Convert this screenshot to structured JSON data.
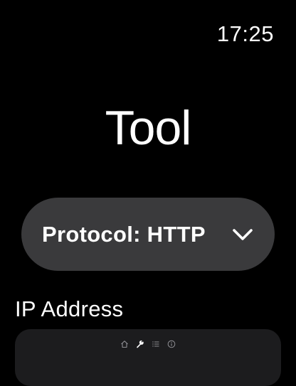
{
  "status_bar": {
    "time": "17:25"
  },
  "page": {
    "title": "Tool"
  },
  "protocol_picker": {
    "label": "Protocol: HTTP",
    "icon": "chevron-down-icon"
  },
  "ip_field": {
    "label": "IP Address",
    "value": ""
  },
  "page_indicator": {
    "icons": [
      "home-icon",
      "wrench-icon",
      "list-icon",
      "info-icon"
    ],
    "active_index": 1
  },
  "colors": {
    "background": "#000000",
    "picker_background": "#3a3a3c",
    "input_background": "#1c1c1e",
    "text": "#ffffff",
    "dot_inactive": "#8e8e93"
  }
}
